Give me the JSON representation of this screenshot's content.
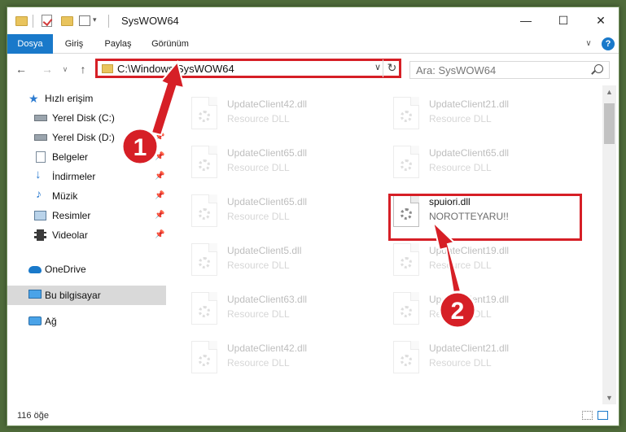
{
  "window": {
    "title": "SysWOW64",
    "controls": {
      "minimize": "—",
      "maximize": "☐",
      "close": "✕"
    },
    "ribbon_expand": "∨",
    "help": "?"
  },
  "ribbon": {
    "tabs": [
      "Dosya",
      "Giriş",
      "Paylaş",
      "Görünüm"
    ]
  },
  "nav": {
    "back": "←",
    "forward": "→",
    "recent": "∨",
    "up": "↑",
    "address": "C:\\Windows\\SysWOW64",
    "address_dropdown": "∨",
    "refresh": "↻",
    "search_placeholder": "Ara: SysWOW64"
  },
  "sidebar": {
    "quick_access": "Hızlı erişim",
    "items": [
      {
        "label": "Yerel Disk (C:)",
        "icon": "drive-icon",
        "pinned": true
      },
      {
        "label": "Yerel Disk (D:)",
        "icon": "drive-icon",
        "pinned": true
      },
      {
        "label": "Belgeler",
        "icon": "documents-icon",
        "pinned": true
      },
      {
        "label": "İndirmeler",
        "icon": "downloads-icon",
        "pinned": true
      },
      {
        "label": "Müzik",
        "icon": "music-icon",
        "pinned": true
      },
      {
        "label": "Resimler",
        "icon": "pictures-icon",
        "pinned": true
      },
      {
        "label": "Videolar",
        "icon": "videos-icon",
        "pinned": true
      }
    ],
    "onedrive": "OneDrive",
    "this_pc": "Bu bilgisayar",
    "network": "Ağ"
  },
  "files": {
    "left": [
      {
        "name": "UpdateClient42.dll",
        "desc": "Resource DLL"
      },
      {
        "name": "UpdateClient65.dll",
        "desc": "Resource DLL"
      },
      {
        "name": "UpdateClient65.dll",
        "desc": "Resource DLL"
      },
      {
        "name": "UpdateClient5.dll",
        "desc": "Resource DLL"
      },
      {
        "name": "UpdateClient63.dll",
        "desc": "Resource DLL"
      },
      {
        "name": "UpdateClient42.dll",
        "desc": "Resource DLL"
      }
    ],
    "right": [
      {
        "name": "UpdateClient21.dll",
        "desc": "Resource DLL"
      },
      {
        "name": "UpdateClient65.dll",
        "desc": "Resource DLL"
      },
      {
        "name": "spuiori.dll",
        "desc": "NOROTTEYARU!!"
      },
      {
        "name": "UpdateClient19.dll",
        "desc": "Resource DLL"
      },
      {
        "name": "UpdateClient19.dll",
        "desc": "Resource DLL"
      },
      {
        "name": "UpdateClient21.dll",
        "desc": "Resource DLL"
      }
    ]
  },
  "status": {
    "item_count": "116 öğe"
  },
  "annotations": {
    "step1": "1",
    "step2": "2",
    "color": "#d61f26"
  }
}
